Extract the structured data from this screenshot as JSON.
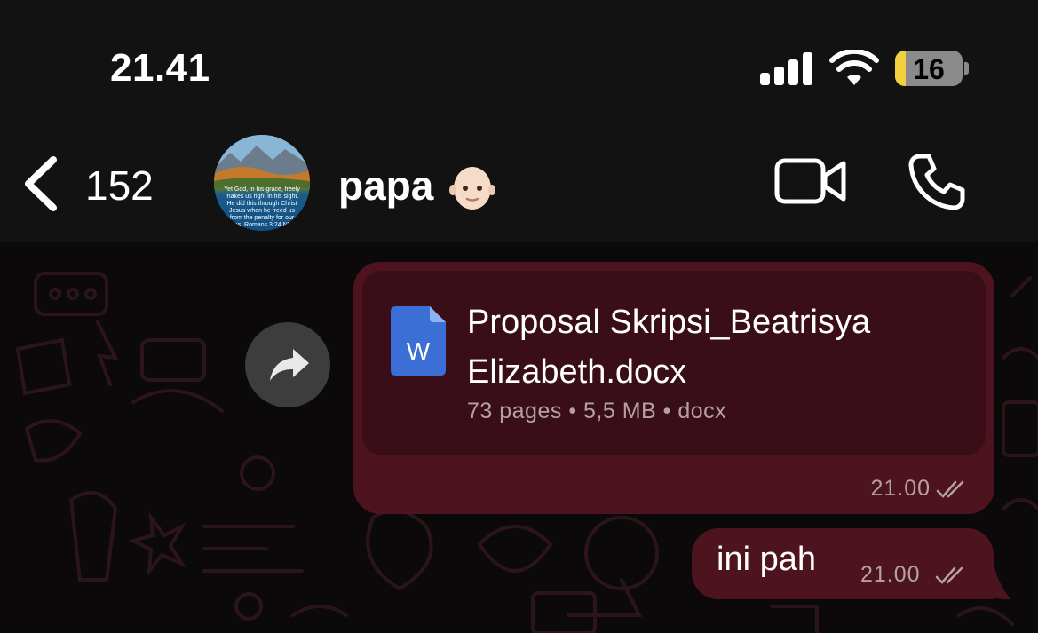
{
  "status_bar": {
    "time": "21.41",
    "battery_level": "16",
    "battery_fraction": 0.16,
    "battery_color": "#f4d03f"
  },
  "header": {
    "back_count": "152",
    "contact_name": "papa",
    "contact_emoji": "bald-person-emoji",
    "avatar_text": "Yet God, in his grace, freely makes us right in his sight. He did this through Christ Jesus when he freed us from the penalty for our sins. Romans 3:24 NLT",
    "icons": [
      "chevron-left-icon",
      "video-call-icon",
      "phone-call-icon"
    ]
  },
  "messages": [
    {
      "type": "document",
      "filename": "Proposal Skripsi_Beatrisya Elizabeth.docx",
      "icon": "word-doc-icon",
      "icon_letter": "W",
      "meta": "73 pages • 5,5 MB • docx",
      "time": "21.00",
      "status": "read-double-tick",
      "bubble_color": "#4d1420"
    },
    {
      "type": "text",
      "text": "ini pah",
      "time": "21.00",
      "status": "read-double-tick",
      "bubble_color": "#4d1420"
    }
  ]
}
